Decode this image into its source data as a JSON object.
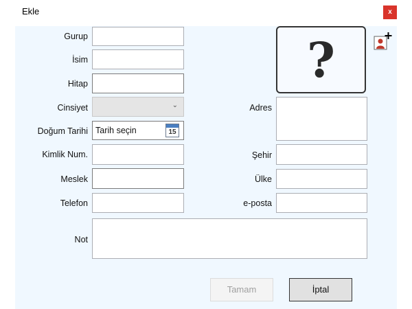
{
  "window": {
    "title": "Ekle",
    "close_label": "x"
  },
  "form": {
    "labels": {
      "group": "Gurup",
      "name": "İsim",
      "title": "Hitap",
      "gender": "Cinsiyet",
      "birth_date": "Doğum Tarihi",
      "id_number": "Kimlik Num.",
      "profession": "Meslek",
      "phone": "Telefon",
      "address": "Adres",
      "city": "Şehir",
      "country": "Ülke",
      "email": "e-posta",
      "note": "Not"
    },
    "values": {
      "group": "",
      "name": "",
      "title": "",
      "gender": "",
      "id_number": "",
      "profession": "",
      "phone": "",
      "address": "",
      "city": "",
      "country": "",
      "email": "",
      "note": ""
    },
    "birth_date_placeholder": "Tarih seçin",
    "calendar_day": "15",
    "photo_placeholder": "?"
  },
  "buttons": {
    "ok": "Tamam",
    "cancel": "İptal"
  },
  "icons": {
    "gender_dropdown": "chevron-down-icon",
    "date_picker": "calendar-icon",
    "add_photo": "add-user-photo-icon"
  }
}
